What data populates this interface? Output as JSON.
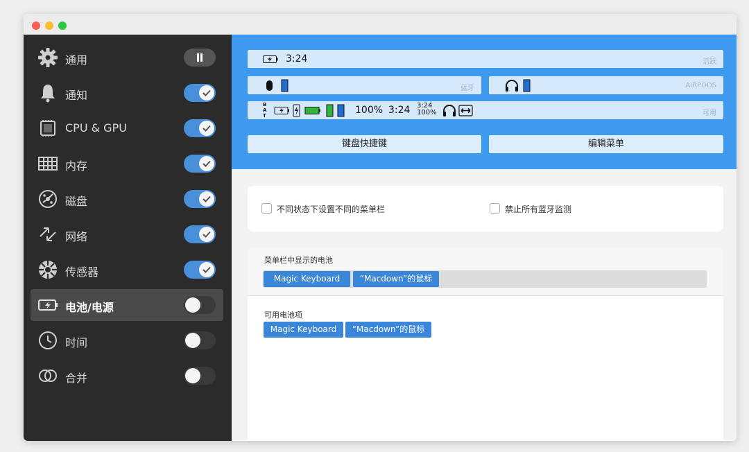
{
  "window": {
    "controls": [
      "close",
      "minimize",
      "zoom"
    ]
  },
  "sidebar": {
    "items": [
      {
        "label": "通用",
        "icon": "gear-icon",
        "toggle": "pause"
      },
      {
        "label": "通知",
        "icon": "bell-icon",
        "toggle": "on"
      },
      {
        "label": "CPU & GPU",
        "icon": "cpu-icon",
        "toggle": "on"
      },
      {
        "label": "内存",
        "icon": "memory-icon",
        "toggle": "on"
      },
      {
        "label": "磁盘",
        "icon": "disk-icon",
        "toggle": "on"
      },
      {
        "label": "网络",
        "icon": "network-arrows-icon",
        "toggle": "on"
      },
      {
        "label": "传感器",
        "icon": "sensor-icon",
        "toggle": "on"
      },
      {
        "label": "电池/电源",
        "icon": "battery-icon",
        "toggle": "off",
        "active": true
      },
      {
        "label": "时间",
        "icon": "clock-icon",
        "toggle": "off"
      },
      {
        "label": "合并",
        "icon": "merge-icon",
        "toggle": "off"
      }
    ]
  },
  "preview": {
    "active_bar": {
      "time": "3:24",
      "tag": "活跃"
    },
    "bluetooth_bar": {
      "tag": "蓝牙"
    },
    "airpods_bar": {
      "tag": "AIRPODS"
    },
    "available_bar": {
      "percent": "100%",
      "time": "3:24",
      "stack_time": "3:24",
      "stack_percent": "100%",
      "bat_letters": "BAT",
      "tag": "可用"
    },
    "buttons": {
      "keyboard_shortcuts": "键盘快捷键",
      "edit_menu": "编辑菜单"
    }
  },
  "options": {
    "different_menubar": "不同状态下设置不同的菜单栏",
    "disable_bluetooth": "禁止所有蓝牙监测"
  },
  "menubar_batteries": {
    "title": "菜单栏中显示的电池",
    "chips": [
      "Magic Keyboard",
      "“Macdown”的鼠标"
    ]
  },
  "available_batteries": {
    "title": "可用电池项",
    "chips": [
      "Magic Keyboard",
      "“Macdown”的鼠标"
    ]
  },
  "colors": {
    "accent": "#3d9aef",
    "sidebar_bg": "#2b2b2b",
    "toggle_on": "#4a8fd9",
    "chip": "#3a86d8"
  }
}
